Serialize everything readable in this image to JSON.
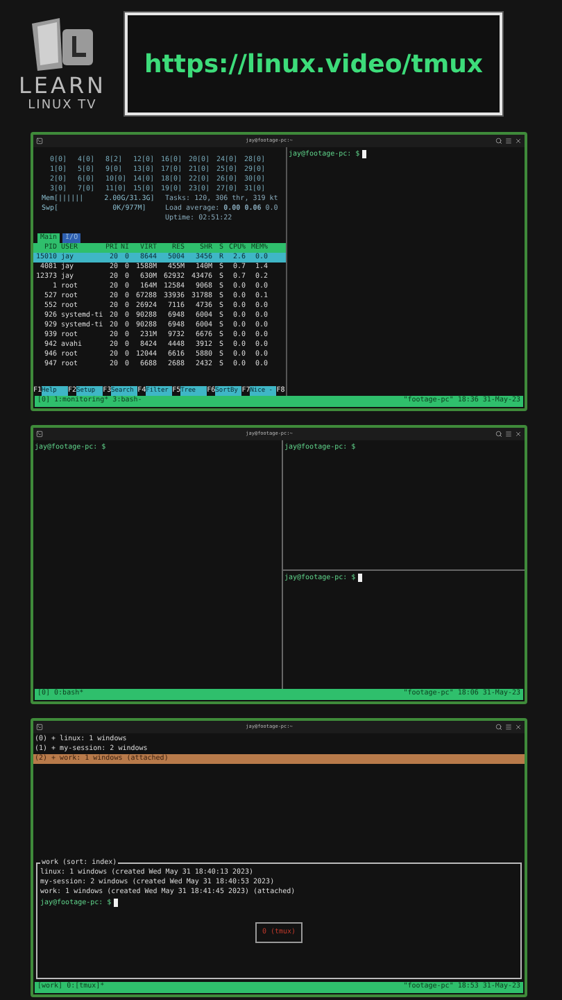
{
  "logo": {
    "line_1": "LEARN",
    "line_2": "LINUX TV"
  },
  "url": "https://linux.video/tmux",
  "windows": [
    {
      "kind": "htop",
      "title": "jay@footage-pc:~",
      "cpus": [
        [
          "0[0]",
          "4[0]",
          "8[2]",
          "12[0]",
          "16[0]",
          "20[0]",
          "24[0]",
          "28[0]"
        ],
        [
          "1[0]",
          "5[0]",
          "9[0]",
          "13[0]",
          "17[0]",
          "21[0]",
          "25[0]",
          "29[0]"
        ],
        [
          "2[0]",
          "6[0]",
          "10[0]",
          "14[0]",
          "18[0]",
          "22[0]",
          "26[0]",
          "30[0]"
        ],
        [
          "3[0]",
          "7[0]",
          "11[0]",
          "15[0]",
          "19[0]",
          "23[0]",
          "27[0]",
          "31[0]"
        ]
      ],
      "memory": [
        "Mem[||||||     2.00G/31.3G]",
        "Swp[             0K/977M]"
      ],
      "summary": [
        "Tasks: 120, 306 thr, 319 kt",
        "Load average: **0.00** **0.06** 0.0",
        "Uptime: 02:51:22"
      ],
      "tabs": [
        {
          "label": "Main",
          "selected": true
        },
        {
          "label": "I/O",
          "selected": false
        }
      ],
      "columns": [
        "PID",
        "USER",
        "PRI",
        "NI",
        "VIRT",
        "RES",
        "SHR",
        "S",
        "CPU%",
        "MEM%"
      ],
      "rows": [
        {
          "selected": true,
          "cells": [
            "15010",
            "jay",
            "20",
            "0",
            "8644",
            "5004",
            "3456",
            "R",
            "2.6",
            "0.0"
          ]
        },
        {
          "selected": false,
          "cells": [
            "4081",
            "jay",
            "20",
            "0",
            "1588M",
            "455M",
            "140M",
            "S",
            "0.7",
            "1.4"
          ]
        },
        {
          "selected": false,
          "cells": [
            "12373",
            "jay",
            "20",
            "0",
            "630M",
            "62932",
            "43476",
            "S",
            "0.7",
            "0.2"
          ]
        },
        {
          "selected": false,
          "cells": [
            "1",
            "root",
            "20",
            "0",
            "164M",
            "12584",
            "9068",
            "S",
            "0.0",
            "0.0"
          ]
        },
        {
          "selected": false,
          "cells": [
            "527",
            "root",
            "20",
            "0",
            "67288",
            "33936",
            "31788",
            "S",
            "0.0",
            "0.1"
          ]
        },
        {
          "selected": false,
          "cells": [
            "552",
            "root",
            "20",
            "0",
            "26924",
            "7116",
            "4736",
            "S",
            "0.0",
            "0.0"
          ]
        },
        {
          "selected": false,
          "cells": [
            "926",
            "systemd-ti",
            "20",
            "0",
            "90288",
            "6948",
            "6004",
            "S",
            "0.0",
            "0.0"
          ]
        },
        {
          "selected": false,
          "cells": [
            "929",
            "systemd-ti",
            "20",
            "0",
            "90288",
            "6948",
            "6004",
            "S",
            "0.0",
            "0.0"
          ]
        },
        {
          "selected": false,
          "cells": [
            "939",
            "root",
            "20",
            "0",
            "231M",
            "9732",
            "6676",
            "S",
            "0.0",
            "0.0"
          ]
        },
        {
          "selected": false,
          "cells": [
            "942",
            "avahi",
            "20",
            "0",
            "8424",
            "4448",
            "3912",
            "S",
            "0.0",
            "0.0"
          ]
        },
        {
          "selected": false,
          "cells": [
            "946",
            "root",
            "20",
            "0",
            "12044",
            "6616",
            "5880",
            "S",
            "0.0",
            "0.0"
          ]
        },
        {
          "selected": false,
          "cells": [
            "947",
            "root",
            "20",
            "0",
            "6688",
            "2688",
            "2432",
            "S",
            "0.0",
            "0.0"
          ]
        }
      ],
      "fkeys": [
        {
          "key": "F1",
          "label": "Help"
        },
        {
          "key": "F2",
          "label": "Setup"
        },
        {
          "key": "F3",
          "label": "Search"
        },
        {
          "key": "F4",
          "label": "Filter"
        },
        {
          "key": "F5",
          "label": "Tree"
        },
        {
          "key": "F6",
          "label": "SortBy"
        },
        {
          "key": "F7",
          "label": "Nice -"
        },
        {
          "key": "F8"
        }
      ],
      "side_prompt": {
        "text": "jay@footage-pc: $",
        "cursor": true
      },
      "status_left": "[0] 1:monitoring* 3:bash-",
      "status_right": "\"footage-pc\" 18:36 31-May-23"
    },
    {
      "kind": "split",
      "title": "jay@footage-pc:~",
      "panes": [
        {
          "text": "jay@footage-pc: $",
          "cursor": false
        },
        {
          "text": "jay@footage-pc: $",
          "cursor": false
        },
        {
          "text": "jay@footage-pc: $",
          "cursor": true
        }
      ],
      "status_left": "[0] 0:bash*",
      "status_right": "\"footage-pc\" 18:06 31-May-23"
    },
    {
      "kind": "chooser",
      "title": "jay@footage-pc:~",
      "sessions": [
        {
          "label": "(0) + linux: 1 windows",
          "selected": false
        },
        {
          "label": "(1) + my-session: 2 windows",
          "selected": false
        },
        {
          "label": "(2) + work: 1 windows (attached)",
          "selected": true
        }
      ],
      "preview": {
        "title": "work (sort: index)",
        "lines": [
          "linux: 1 windows (created Wed May 31 18:40:13 2023)",
          "my-session: 2 windows (created Wed May 31 18:40:53 2023)",
          "work: 1 windows (created Wed May 31 18:41:45 2023) (attached)"
        ],
        "prompt": {
          "text": "jay@footage-pc: $",
          "cursor": true
        },
        "pane_label": "0 (tmux)"
      },
      "status_left": "[work] 0:[tmux]*",
      "status_right": "\"footage-pc\" 18:53 31-May-23"
    }
  ]
}
